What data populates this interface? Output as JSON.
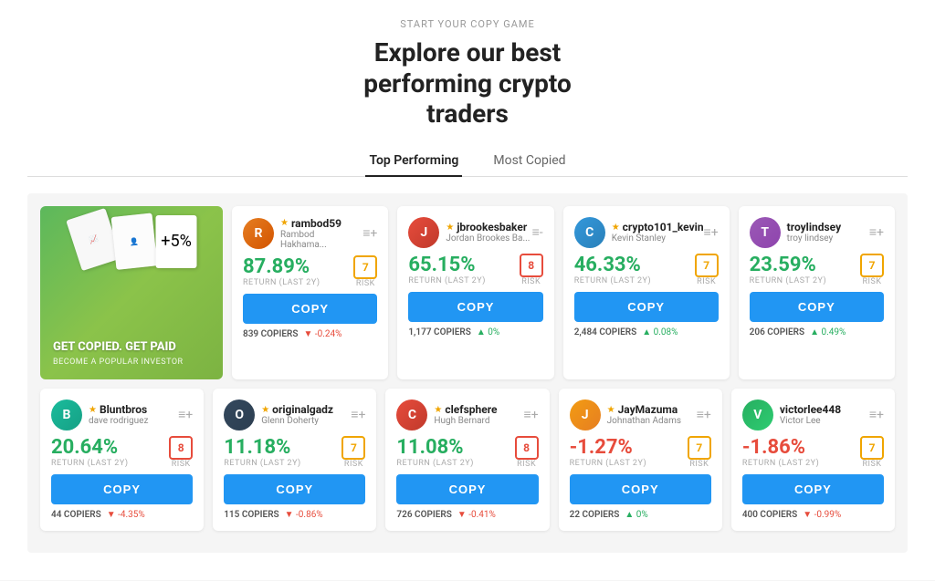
{
  "header": {
    "start_label": "START YOUR COPY GAME",
    "title_line1": "Explore our best",
    "title_line2": "performing crypto",
    "title_line3": "traders"
  },
  "tabs": [
    {
      "label": "Top Performing",
      "active": true
    },
    {
      "label": "Most Copied",
      "active": false
    }
  ],
  "hero_card": {
    "title": "GET COPIED. GET PAID",
    "subtitle": "BECOME A POPULAR INVESTOR"
  },
  "row1_traders": [
    {
      "username": "rambod59",
      "fullname": "Rambod Hakhama...",
      "star": true,
      "return_value": "87.89%",
      "return_label": "RETURN (LAST 2Y)",
      "risk": "7",
      "risk_type": "orange",
      "risk_label": "RISK",
      "copiers": "839 COPIERS",
      "change": "-0.24%",
      "change_dir": "down",
      "avatar_class": "avatar-rambod",
      "avatar_letter": "R"
    },
    {
      "username": "jbrookesbaker",
      "fullname": "Jordan Brookes Ba...",
      "star": true,
      "return_value": "65.15%",
      "return_label": "RETURN (LAST 2Y)",
      "risk": "8",
      "risk_type": "red",
      "risk_label": "RISK",
      "copiers": "1,177 COPIERS",
      "change": "0%",
      "change_dir": "up",
      "avatar_class": "avatar-jbrookesbaker",
      "avatar_letter": "J"
    },
    {
      "username": "crypto101_kevin",
      "fullname": "Kevin Stanley",
      "star": true,
      "return_value": "46.33%",
      "return_label": "RETURN (LAST 2Y)",
      "risk": "7",
      "risk_type": "orange",
      "risk_label": "RISK",
      "copiers": "2,484 COPIERS",
      "change": "0.08%",
      "change_dir": "up",
      "avatar_class": "avatar-crypto101",
      "avatar_letter": "C"
    },
    {
      "username": "troylindsey",
      "fullname": "troy lindsey",
      "star": false,
      "return_value": "23.59%",
      "return_label": "RETURN (LAST 2Y)",
      "risk": "7",
      "risk_type": "orange",
      "risk_label": "RISK",
      "copiers": "206 COPIERS",
      "change": "0.49%",
      "change_dir": "up",
      "avatar_class": "avatar-troy",
      "avatar_letter": "T"
    }
  ],
  "row2_traders": [
    {
      "username": "Bluntbros",
      "fullname": "dave rodriguez",
      "star": true,
      "return_value": "20.64%",
      "return_label": "RETURN (LAST 2Y)",
      "risk": "8",
      "risk_type": "red",
      "risk_label": "RISK",
      "copiers": "44 COPIERS",
      "change": "-4.35%",
      "change_dir": "down",
      "avatar_class": "avatar-blunt",
      "avatar_letter": "B"
    },
    {
      "username": "originalgadz",
      "fullname": "Glenn Doherty",
      "star": true,
      "return_value": "11.18%",
      "return_label": "RETURN (LAST 2Y)",
      "risk": "7",
      "risk_type": "orange",
      "risk_label": "RISK",
      "copiers": "115 COPIERS",
      "change": "-0.86%",
      "change_dir": "down",
      "avatar_class": "avatar-original",
      "avatar_letter": "O"
    },
    {
      "username": "clefsphere",
      "fullname": "Hugh Bernard",
      "star": true,
      "return_value": "11.08%",
      "return_label": "RETURN (LAST 2Y)",
      "risk": "8",
      "risk_type": "red",
      "risk_label": "RISK",
      "copiers": "726 COPIERS",
      "change": "-0.41%",
      "change_dir": "down",
      "avatar_class": "avatar-clef",
      "avatar_letter": "C"
    },
    {
      "username": "JayMazuma",
      "fullname": "Johnathan Adams",
      "star": true,
      "return_value": "-1.27%",
      "return_label": "RETURN (LAST 2Y)",
      "risk": "7",
      "risk_type": "orange",
      "risk_label": "RISK",
      "copiers": "22 COPIERS",
      "change": "0%",
      "change_dir": "neutral",
      "avatar_class": "avatar-jay",
      "avatar_letter": "J"
    },
    {
      "username": "victorlee448",
      "fullname": "Victor Lee",
      "star": false,
      "return_value": "-1.86%",
      "return_label": "RETURN (LAST 2Y)",
      "risk": "7",
      "risk_type": "orange",
      "risk_label": "RISK",
      "copiers": "400 COPIERS",
      "change": "-0.99%",
      "change_dir": "down",
      "avatar_class": "avatar-victor",
      "avatar_letter": "V"
    }
  ],
  "copy_button_label": "COPY"
}
